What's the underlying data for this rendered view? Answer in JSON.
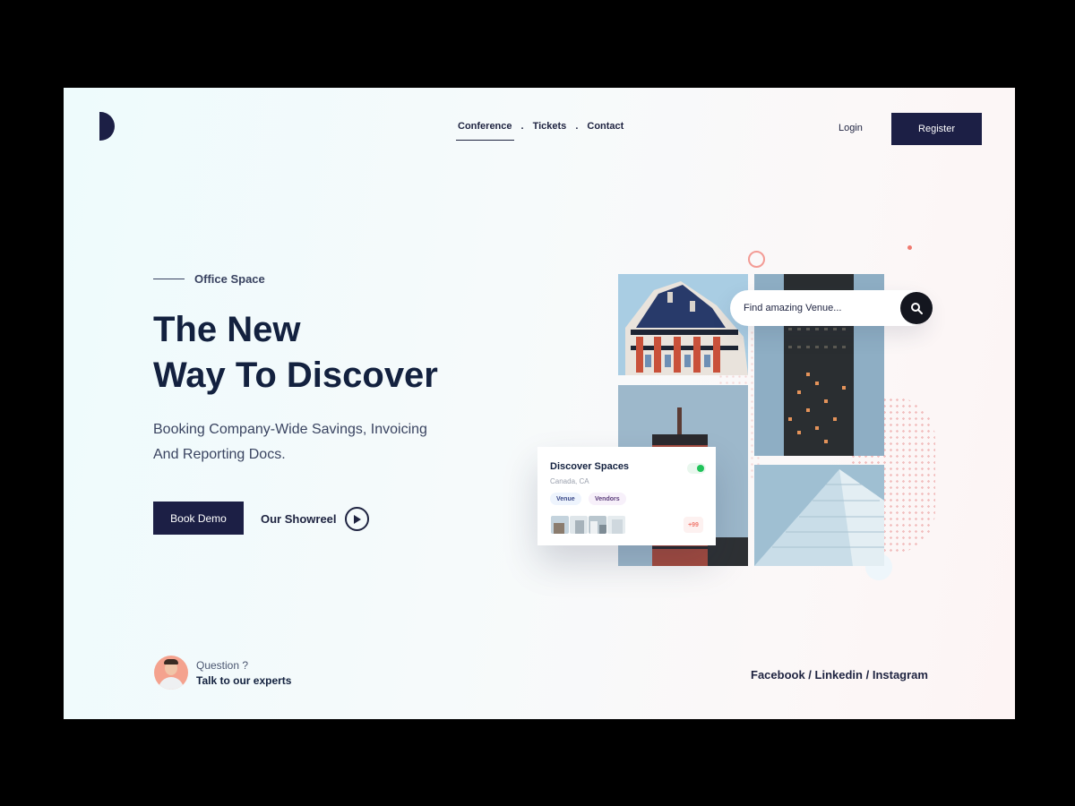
{
  "header": {
    "nav": [
      {
        "label": "Conference",
        "active": true
      },
      {
        "label": "Tickets",
        "active": false
      },
      {
        "label": "Contact",
        "active": false
      }
    ],
    "separator": ".",
    "login_label": "Login",
    "register_label": "Register"
  },
  "hero": {
    "eyebrow": "Office Space",
    "headline_line1": "The New",
    "headline_line2": "Way To Discover",
    "subtitle_line1": "Booking Company-Wide Savings, Invoicing",
    "subtitle_line2": "And Reporting Docs.",
    "book_demo_label": "Book Demo",
    "showreel_label": "Our Showreel"
  },
  "search": {
    "placeholder": "Find amazing Venue..."
  },
  "card": {
    "title": "Discover Spaces",
    "location": "Canada, CA",
    "tags": [
      "Venue",
      "Vendors"
    ],
    "more_count": "+99",
    "toggle_on": true
  },
  "footer": {
    "question": "Question ?",
    "cta": "Talk to our experts",
    "social": [
      "Facebook",
      "Linkedin",
      "Instagram"
    ],
    "social_separator": " / "
  },
  "icons": {
    "logo": "half-circle-logo-icon",
    "play": "play-icon",
    "search": "search-icon"
  },
  "colors": {
    "primary": "#1c1f45",
    "heading": "#13213f",
    "accent_coral": "#f07a70",
    "toggle_green": "#20c35a"
  }
}
